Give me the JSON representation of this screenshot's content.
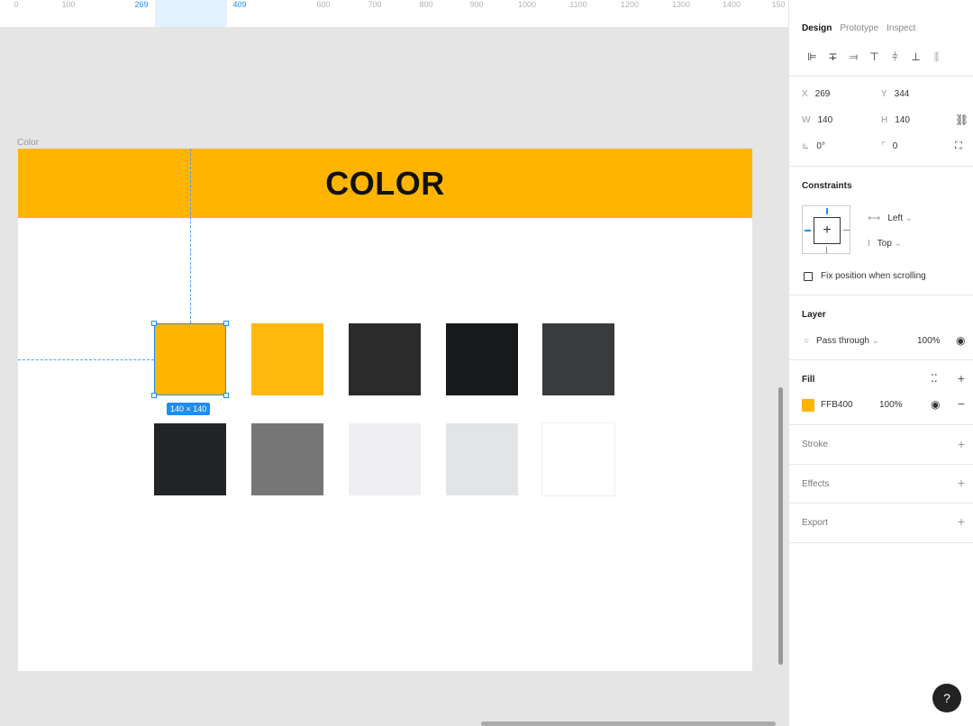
{
  "ruler": {
    "labels": [
      "0",
      "100",
      "269",
      "409",
      "600",
      "700",
      "800",
      "900",
      "1000",
      "1100",
      "1200",
      "1300",
      "1400",
      "150"
    ]
  },
  "frame": {
    "name": "Color",
    "title": "COLOR"
  },
  "selection": {
    "size": "140 × 140"
  },
  "swatches": {
    "row1": [
      "#ffb400",
      "#ffb80d",
      "#2b2b2b",
      "#18191b",
      "#3a3b3d"
    ],
    "row2": [
      "#232426",
      "#767676",
      "#efeff3",
      "#e3e4e8",
      "#ffffff"
    ]
  },
  "panel": {
    "tabs": [
      "Design",
      "Prototype",
      "Inspect"
    ],
    "x_label": "X",
    "x": "269",
    "y_label": "Y",
    "y": "344",
    "w_label": "W",
    "w": "140",
    "h_label": "H",
    "h": "140",
    "rotation": "0°",
    "radius": "0",
    "constraints_title": "Constraints",
    "constraint_h": "Left",
    "constraint_v": "Top",
    "fix_position": "Fix position when scrolling",
    "layer_title": "Layer",
    "blend": "Pass through",
    "layer_opacity": "100%",
    "fill_title": "Fill",
    "fill_hex": "FFB400",
    "fill_opacity": "100%",
    "stroke_title": "Stroke",
    "effects_title": "Effects",
    "export_title": "Export"
  },
  "help": "?"
}
